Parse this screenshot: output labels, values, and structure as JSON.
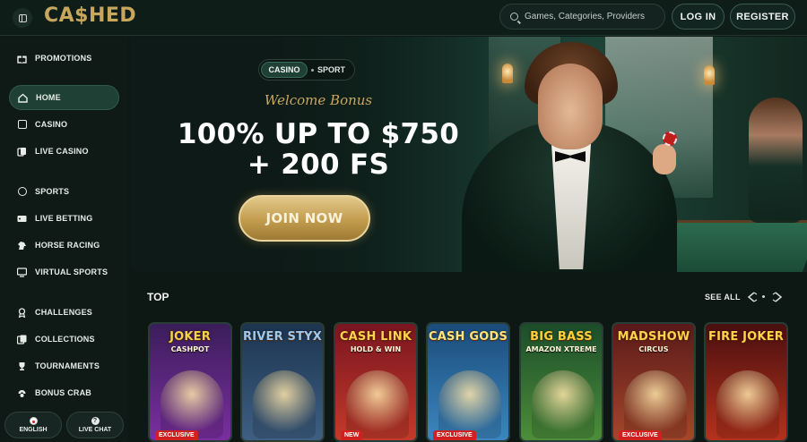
{
  "header": {
    "logo": "CA$HED",
    "search_placeholder": "Games, Categories, Providers",
    "login_label": "LOG IN",
    "register_label": "REGISTER"
  },
  "sidebar": {
    "items": [
      {
        "label": "PROMOTIONS",
        "icon": "gift-icon"
      },
      {
        "label": "HOME",
        "icon": "home-icon",
        "active": true
      },
      {
        "label": "CASINO",
        "icon": "slot-machine-icon"
      },
      {
        "label": "LIVE CASINO",
        "icon": "cards-icon"
      },
      {
        "label": "SPORTS",
        "icon": "ball-icon"
      },
      {
        "label": "LIVE BETTING",
        "icon": "live-icon"
      },
      {
        "label": "HORSE RACING",
        "icon": "horse-icon"
      },
      {
        "label": "VIRTUAL SPORTS",
        "icon": "monitor-icon"
      },
      {
        "label": "CHALLENGES",
        "icon": "medal-icon"
      },
      {
        "label": "COLLECTIONS",
        "icon": "collections-icon"
      },
      {
        "label": "TOURNAMENTS",
        "icon": "trophy-icon"
      },
      {
        "label": "BONUS CRAB",
        "icon": "crab-icon"
      }
    ],
    "language_label": "ENGLISH",
    "live_chat_label": "LIVE CHAT"
  },
  "hero": {
    "toggle_casino": "CASINO",
    "toggle_sport": "SPORT",
    "welcome": "Welcome Bonus",
    "title_line1": "100% UP TO $750",
    "title_line2": "+ 200 FS",
    "cta": "JOIN NOW"
  },
  "top": {
    "title": "TOP",
    "see_all": "SEE ALL",
    "games": [
      {
        "title": "JOKER",
        "sub": "CASHPOT",
        "badge": "EXCLUSIVE",
        "colors": [
          "#3b1d5a",
          "#7a2fa0"
        ]
      },
      {
        "title": "RIVER STYX",
        "sub": "",
        "badge": "",
        "colors": [
          "#1d3550",
          "#3e5f83"
        ]
      },
      {
        "title": "CASH LINK",
        "sub": "HOLD & WIN",
        "badge": "NEW",
        "colors": [
          "#7a1520",
          "#c43a2a"
        ]
      },
      {
        "title": "CASH GODS",
        "sub": "",
        "badge": "EXCLUSIVE",
        "colors": [
          "#1b4c7a",
          "#3b86c0"
        ]
      },
      {
        "title": "BIG BASS",
        "sub": "AMAZON XTREME",
        "badge": "",
        "colors": [
          "#1c4d2a",
          "#4c8e3a"
        ]
      },
      {
        "title": "MADSHOW",
        "sub": "CIRCUS",
        "badge": "EXCLUSIVE",
        "colors": [
          "#5a1a1a",
          "#a5462a"
        ]
      },
      {
        "title": "FIRE JOKER",
        "sub": "",
        "badge": "",
        "colors": [
          "#4a0f0f",
          "#b5321c"
        ]
      }
    ]
  }
}
